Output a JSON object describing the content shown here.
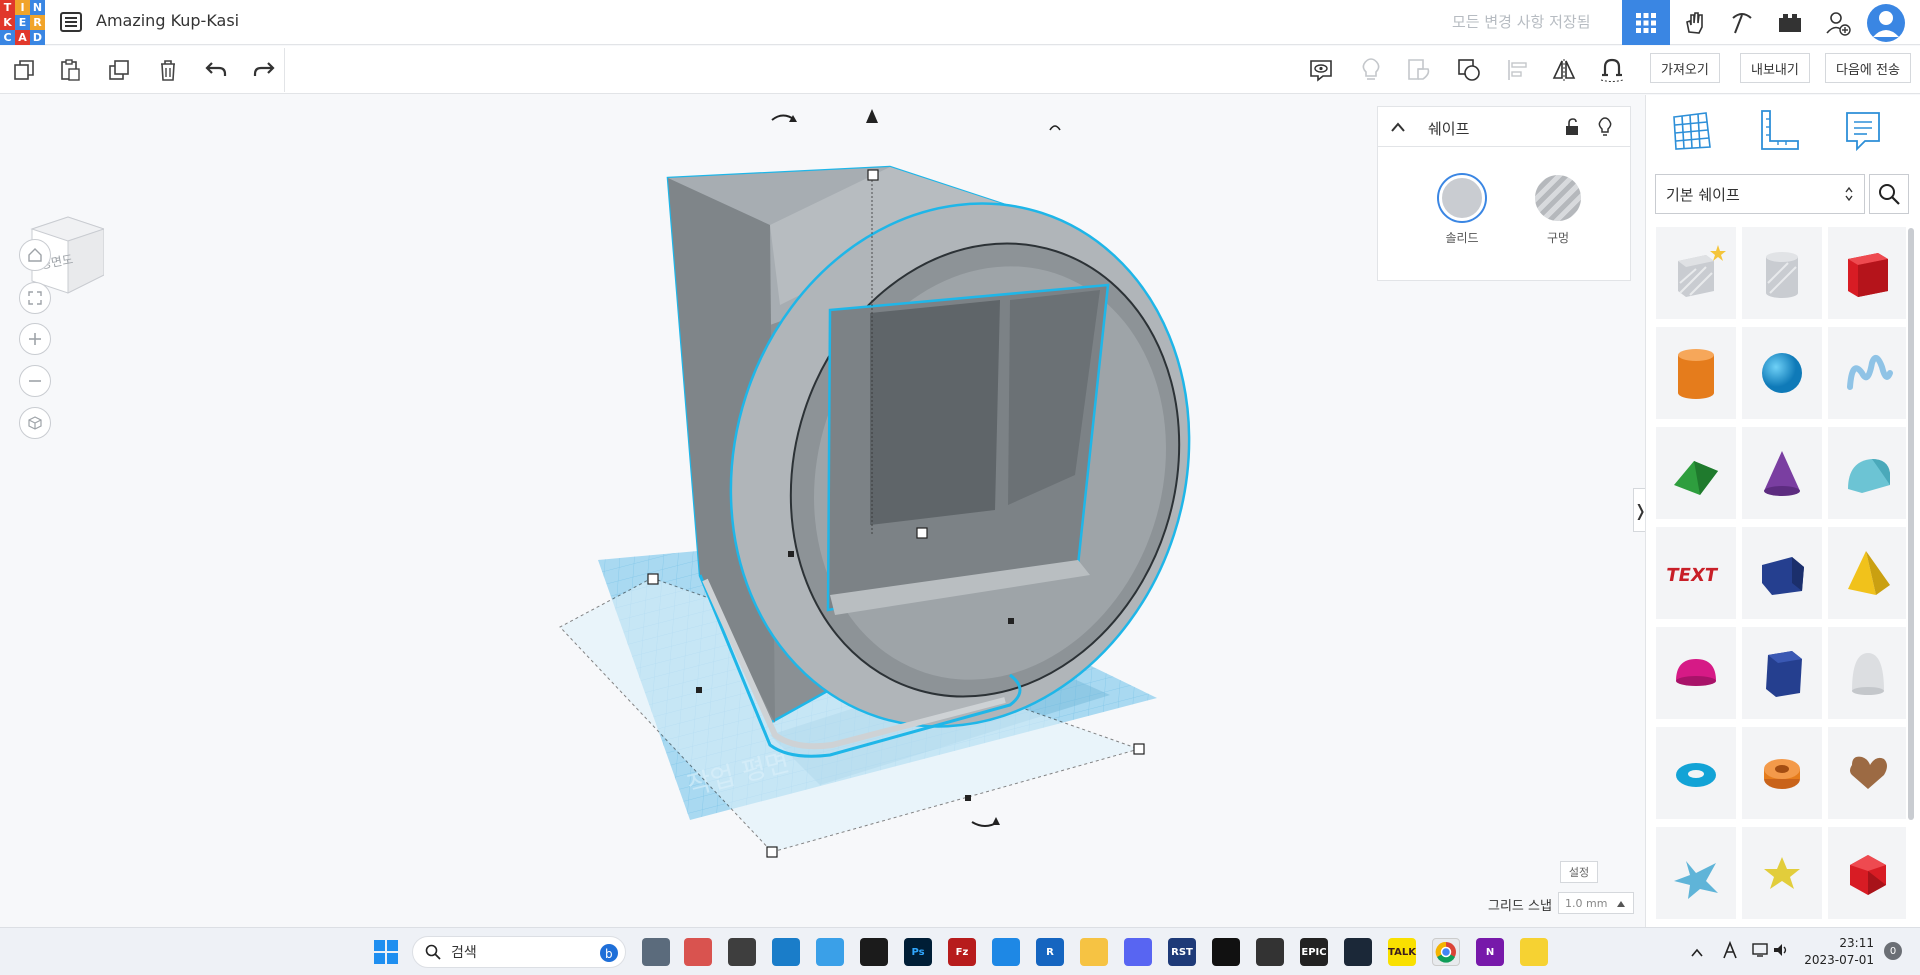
{
  "app": {
    "logo_letters": [
      "T",
      "I",
      "N",
      "K",
      "E",
      "R",
      "C",
      "A",
      "D"
    ],
    "logo_colors": [
      "#e1382b",
      "#f1a42a",
      "#3a86e3",
      "#e1382b",
      "#3a86e3",
      "#f1a42a",
      "#3a86e3",
      "#e1382b",
      "#3a86e3"
    ],
    "project_title": "Amazing Kup-Kasi",
    "save_status": "모든 변경 사항 저장됨"
  },
  "toolbar": {
    "import_label": "가져오기",
    "export_label": "내보내기",
    "send_label": "다음에 전송"
  },
  "viewport": {
    "viewcube_label": "정면도",
    "workplane_label": "작업 평면"
  },
  "shape_panel": {
    "title": "쉐이프",
    "solid_label": "솔리드",
    "hole_label": "구멍"
  },
  "sidebar": {
    "category": "기본 쉐이프",
    "shapes": [
      "striped-box",
      "striped-cylinder",
      "box",
      "cylinder",
      "sphere",
      "scribble",
      "roof",
      "cone",
      "round-roof",
      "text",
      "wedge",
      "pyramid",
      "half-sphere",
      "polygon",
      "paraboloid",
      "torus",
      "tube",
      "heart",
      "star",
      "star-gold",
      "icosahedron"
    ]
  },
  "footer": {
    "settings_label": "설정",
    "grid_snap_label": "그리드 스냅",
    "grid_snap_value": "1.0 mm"
  },
  "taskbar": {
    "search_placeholder": "검색",
    "time": "23:11",
    "date": "2023-07-01",
    "notification_count": "0"
  },
  "colors": {
    "accent": "#3a86e3",
    "selection": "#1fb6e8",
    "workplane": "#9fd4f0"
  }
}
